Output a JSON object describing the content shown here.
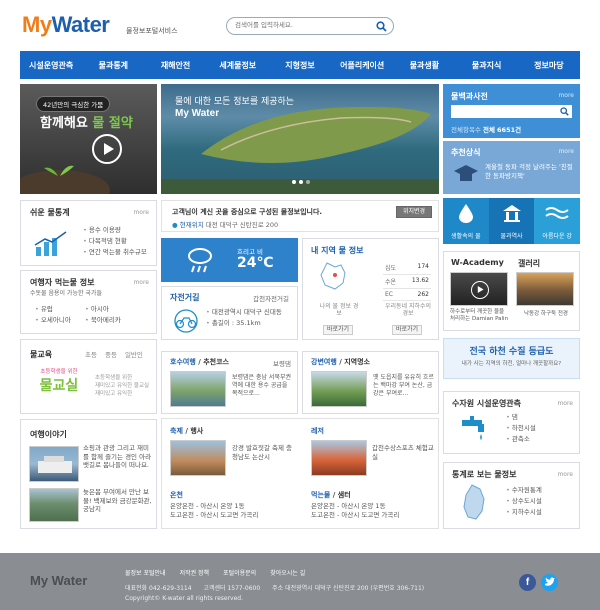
{
  "header": {
    "logo_my": "My",
    "logo_water": "Water",
    "logo_sub": "물정보포털서비스",
    "search_placeholder": "검색어를 입력하세요."
  },
  "gnb": [
    "시설운영관측",
    "물과통계",
    "재해안전",
    "세계물정보",
    "지형정보",
    "어플리케이션",
    "물과생활",
    "물과지식",
    "정보마당"
  ],
  "banner_left": {
    "pill": "42년만의 극심한 가뭄",
    "line1": "함께해요",
    "line2": "물 절약"
  },
  "main_visual": {
    "caption": "물에 대한 모든 정보를 제공하는",
    "logo": "My Water"
  },
  "search_box": {
    "title": "물백과사전",
    "more": "more",
    "result_prefix": "전체항목수",
    "result_label": "전체",
    "result_count": "6651건"
  },
  "recommend": {
    "title": "추천상식",
    "more": "more",
    "text": "계울철 동파 걱정 날려주는 '친절한 동파방지책'"
  },
  "notice": {
    "text": "고객님이 계신 곳을 중심으로 구성된 물정보입니다.",
    "btn": "위치변경",
    "loc_label": "현재위치",
    "loc_value": "대전 대덕구 신탄진로 200"
  },
  "quick": [
    {
      "label": "생활속의 물"
    },
    {
      "label": "물과역사"
    },
    {
      "label": "아름다운 강"
    }
  ],
  "easy_stats": {
    "title": "쉬운 물통계",
    "more": "more",
    "items": [
      "용수 이용량",
      "다목적댐 현황",
      "연간 먹는물 취수규모"
    ]
  },
  "travel_water": {
    "title": "여행자 먹는물 정보",
    "more": "more",
    "sub": "수돗물 음용이 가능한 국가들",
    "col1": [
      "유럽",
      "오세아니아"
    ],
    "col2": [
      "아시아",
      "북아메리카"
    ]
  },
  "edu": {
    "title": "물교육",
    "tabs": [
      "초등",
      "중등",
      "일반인"
    ],
    "img_line1": "초등학생을 위한",
    "img_line2": "물교실",
    "desc": [
      "초등학생을 위한",
      "재미있고 유익한 물교실",
      "재미있고 유익한"
    ]
  },
  "story": {
    "title": "여행이야기",
    "items": [
      "쇼핑과 관광 그리고 재미를 함께 즐기는 경인 아라뱃길로 봄나들이 떠나요.",
      "늦은봄 부여에서 만난 보물! 백제보와 금강문화관, 궁남지"
    ]
  },
  "weather": {
    "label": "흐리고 비",
    "temp": "24℃"
  },
  "bike": {
    "title": "자전거길",
    "right": "갑천자전거길",
    "items": [
      "대전광역시 대덕구 신대동",
      "총길이 : 35.1km"
    ]
  },
  "local": {
    "title": "내 지역 물 정보",
    "stats": [
      {
        "k": "심도",
        "v": "174"
      },
      {
        "k": "수온",
        "v": "13.62"
      },
      {
        "k": "EC",
        "v": "262"
      }
    ],
    "a_label": "나의 물 정보 경보",
    "b_label": "우리동네 지하수의 경보",
    "btn_a": "바로가기",
    "btn_b": "바로가기"
  },
  "lake": {
    "title": "호수여행",
    "title2": "추천코스",
    "right": "보령댐",
    "text": "보령댐은 충남 서북부권역에 대한 용수 공급을 목적으로..."
  },
  "river": {
    "title": "강변여행",
    "title2": "지역명소",
    "text": "옛 도읍지를 유유히 흐르는 백마강 부여 논산, 금강은 부여로..."
  },
  "festival": {
    "title": "축제",
    "title2": "행사",
    "text": "강경 발효젓갈 축제 충청남도 논산시"
  },
  "leisure": {
    "title": "레저",
    "text": "갑천수상스포츠 체험교실"
  },
  "hotspring": {
    "title": "온천",
    "items": [
      "온양온천 - 아산시 온양 1동",
      "도고온천 - 아산시 도고면 가곡리"
    ]
  },
  "food": {
    "title": "먹는물",
    "title2": "샘터",
    "items": [
      "온양온천 - 아산시 온양 1동",
      "도고온천 - 아산시 도고면 가곡리"
    ]
  },
  "academy": {
    "title": "W-Academy",
    "caption": "하수로부터 깨끗한 물을 처리하는 Damian Palin"
  },
  "gallery": {
    "title": "갤러리",
    "caption": "낙동강 하구둑 전경"
  },
  "river_banner": {
    "title": "전국 하천 수질 등급도",
    "sub": "내가 사는 지역의 하천, 얼마나 깨끗할까요?"
  },
  "facility": {
    "title": "수자원 시설운영관측",
    "more": "more",
    "items": [
      "댐",
      "하천시설",
      "관측소"
    ]
  },
  "statmap": {
    "title": "통계로 보는 물정보",
    "more": "more",
    "items": [
      "수자원통계",
      "상수도시설",
      "지하수시설"
    ]
  },
  "footer": {
    "links": [
      "물정보 포털안내",
      "저작권 정책",
      "포털이용문의",
      "찾아오시는 길"
    ],
    "phone_label": "대표전화",
    "phone": "042-629-3114",
    "fax_label": "고객센터",
    "fax": "1577-0600",
    "addr_label": "주소",
    "addr": "대전광역시 대덕구 신탄진로 200 (우편번호 306-711)",
    "copy": "Copyright© K-water all rights reserved.",
    "logo": "My Water"
  }
}
